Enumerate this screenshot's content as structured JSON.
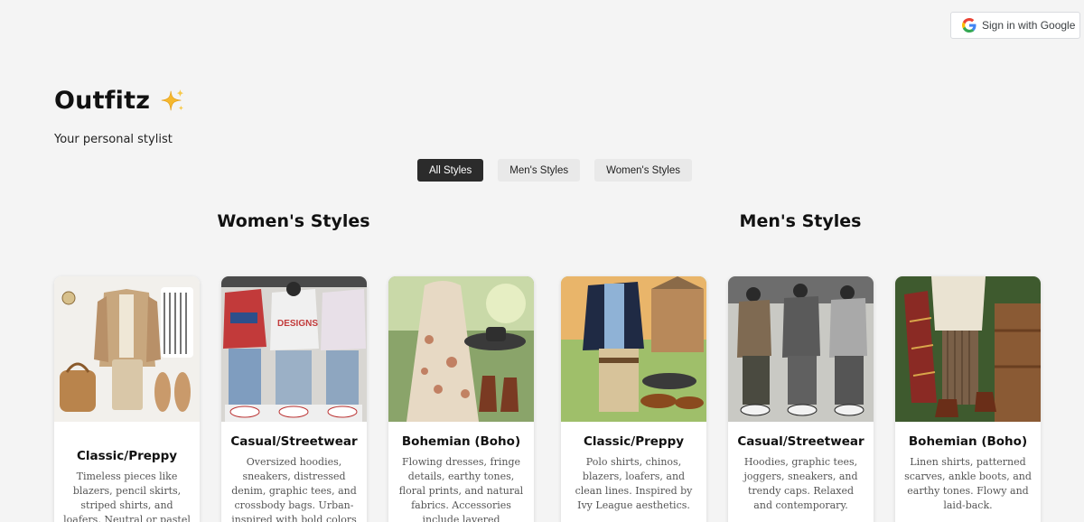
{
  "auth": {
    "signin_label": "Sign in with Google",
    "icon": "google-g-icon"
  },
  "brand": {
    "title": "Outfitz",
    "emoji_icon": "sparkles-icon",
    "tagline": "Your personal stylist"
  },
  "filters": [
    {
      "label": "All Styles",
      "active": true
    },
    {
      "label": "Men's Styles",
      "active": false
    },
    {
      "label": "Women's Styles",
      "active": false
    }
  ],
  "sections": {
    "women": {
      "title": "Women's Styles",
      "cards": [
        {
          "title": "Classic/Preppy",
          "desc": "Timeless pieces like blazers, pencil skirts, striped shirts, and loafers. Neutral or pastel palettes"
        },
        {
          "title": "Casual/Streetwear",
          "desc": "Oversized hoodies, sneakers, distressed denim, graphic tees, and crossbody bags. Urban-inspired with bold colors"
        },
        {
          "title": "Bohemian (Boho)",
          "desc": "Flowing dresses, fringe details, earthy tones, floral prints, and natural fabrics. Accessories include layered necklaces and"
        }
      ]
    },
    "men": {
      "title": "Men's Styles",
      "cards": [
        {
          "title": "Classic/Preppy",
          "desc": "Polo shirts, chinos, blazers, loafers, and clean lines. Inspired by Ivy League aesthetics."
        },
        {
          "title": "Casual/Streetwear",
          "desc": "Hoodies, graphic tees, joggers, sneakers, and trendy caps. Relaxed and contemporary."
        },
        {
          "title": "Bohemian (Boho)",
          "desc": "Linen shirts, patterned scarves, ankle boots, and earthy tones. Flowy and laid-back."
        }
      ]
    }
  }
}
